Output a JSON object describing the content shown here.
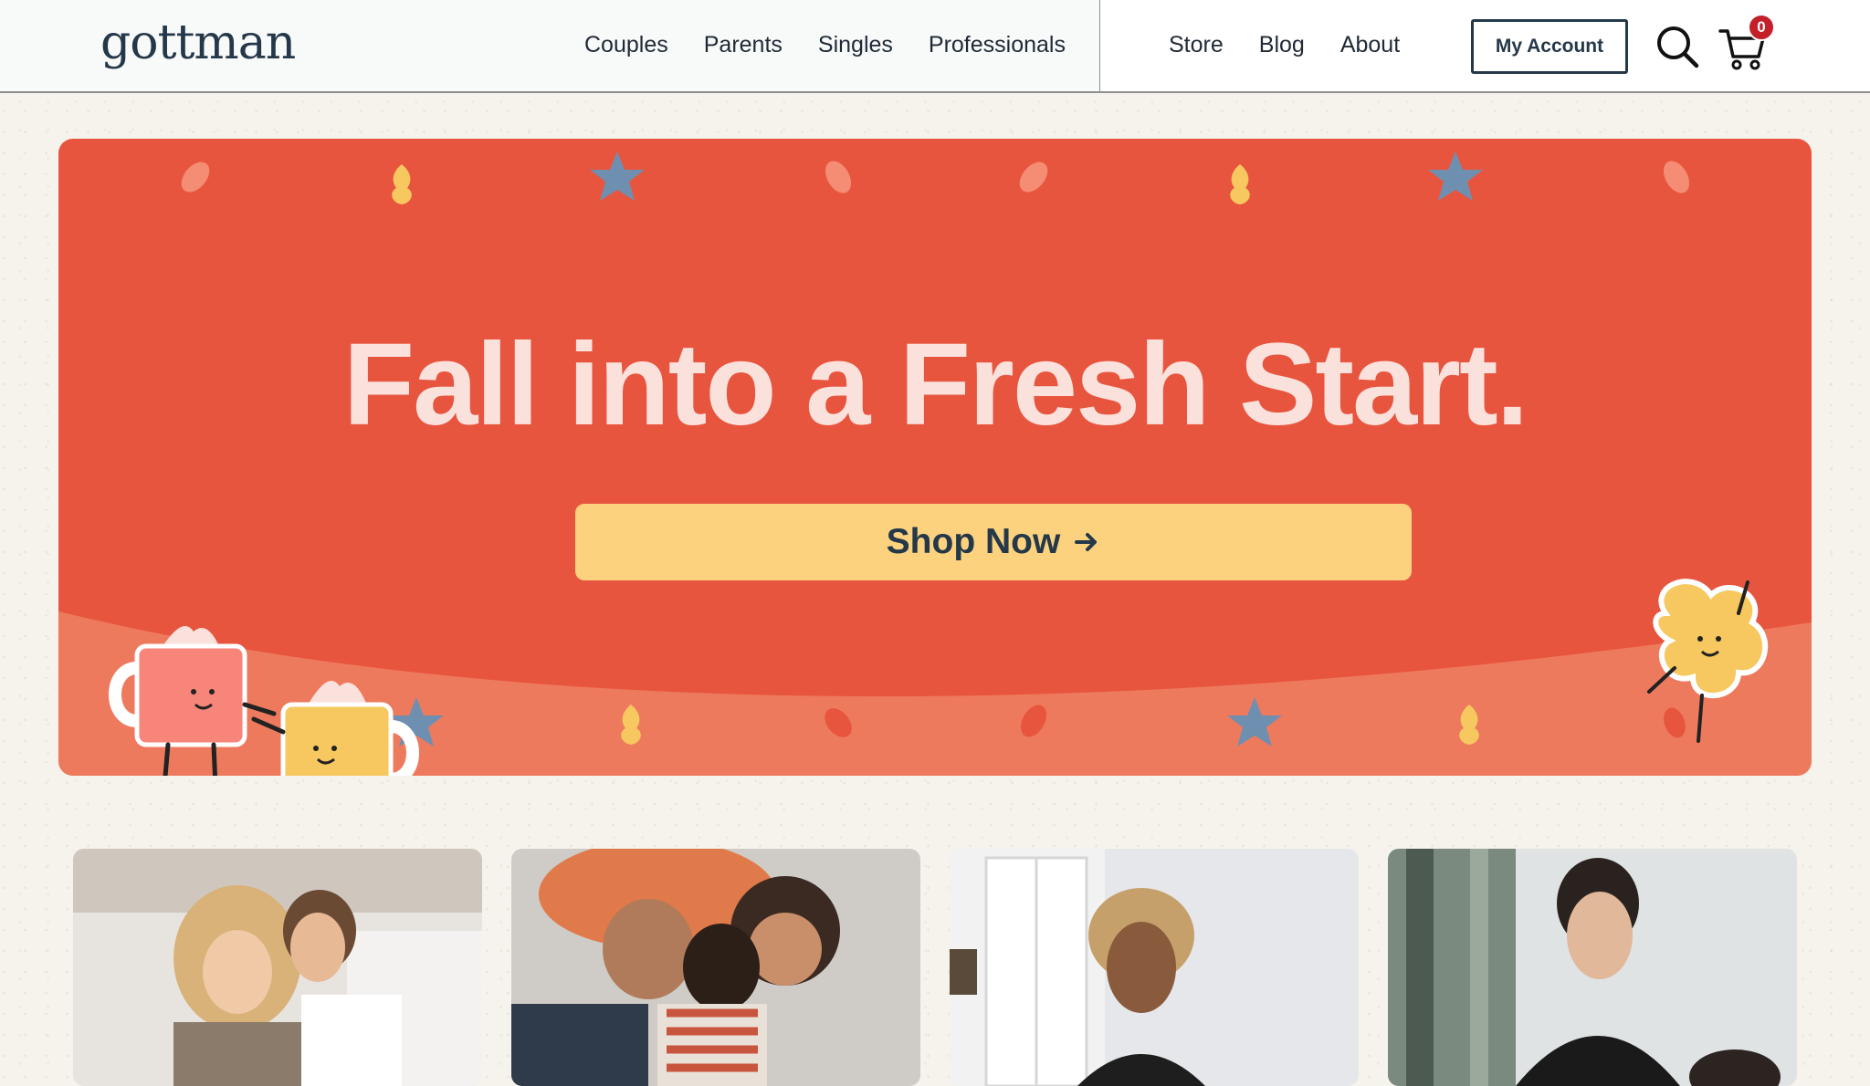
{
  "header": {
    "logo": "gottman",
    "nav_main": [
      "Couples",
      "Parents",
      "Singles",
      "Professionals"
    ],
    "nav_secondary": [
      "Store",
      "Blog",
      "About"
    ],
    "account_label": "My Account",
    "cart_count": "0",
    "icons": {
      "search": "search-icon",
      "cart": "cart-icon"
    }
  },
  "hero": {
    "title": "Fall into a Fresh Start.",
    "button_label": "Shop Now",
    "button_icon": "arrow-right-icon",
    "colors": {
      "background": "#e8553e",
      "title": "#fbe1dc",
      "button": "#fcd27f",
      "wave": "#ee7a5e"
    }
  },
  "cards": [
    {
      "subject": "couple photo"
    },
    {
      "subject": "family photo"
    },
    {
      "subject": "single person photo"
    },
    {
      "subject": "professional photo"
    }
  ]
}
